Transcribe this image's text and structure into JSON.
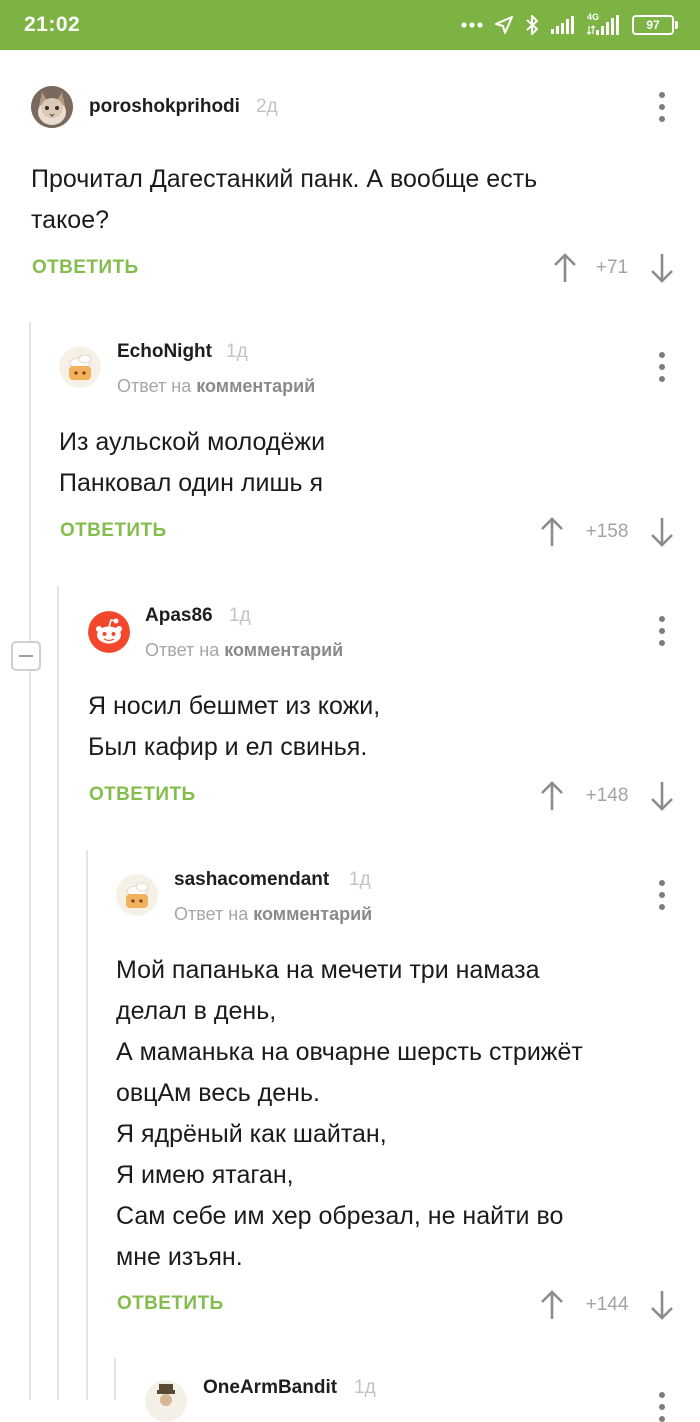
{
  "status_bar": {
    "time": "21:02",
    "network_label": "4G",
    "battery": "97",
    "icons": [
      "more-dots-icon",
      "location-arrow-icon",
      "bluetooth-icon",
      "signal-icon",
      "signal-4g-icon",
      "battery-icon"
    ]
  },
  "colors": {
    "status_bar": "#7cb342",
    "reply_button": "#84bd4e",
    "thread_line": "#e4e4e4",
    "text": "#1b1b1b"
  },
  "comments": [
    {
      "username": "poroshokprihodi",
      "age": "2д",
      "text": "Прочитал Дагестанкий панк. А вообще есть\nтакое?",
      "reply_label": "ОТВЕТИТЬ",
      "rating": "+71"
    },
    {
      "username": "EchoNight",
      "age": "1д",
      "reply_prefix": "Ответ на ",
      "reply_target": "комментарий",
      "text": "Из аульской молодёжи\nПанковал один лишь я",
      "reply_label": "ОТВЕТИТЬ",
      "rating": "+158"
    },
    {
      "username": "Apas86",
      "age": "1д",
      "reply_prefix": "Ответ на ",
      "reply_target": "комментарий",
      "text": "Я носил бешмет из кожи,\nБыл кафир и ел свинья.",
      "reply_label": "ОТВЕТИТЬ",
      "rating": "+148"
    },
    {
      "username": "sashacomendant",
      "age": "1д",
      "reply_prefix": "Ответ на ",
      "reply_target": "комментарий",
      "text": "Мой папанька на мечети три намаза\nделал в день,\nА маманька на овчарне шерсть стрижёт\nовцАм весь день.\nЯ ядрёный как шайтан,\nЯ имею ятаган,\nСам себе им хер обрезал, не найти во\nмне изъян.",
      "reply_label": "ОТВЕТИТЬ",
      "rating": "+144"
    },
    {
      "username": "OneArmBandit",
      "age": "1д"
    }
  ]
}
